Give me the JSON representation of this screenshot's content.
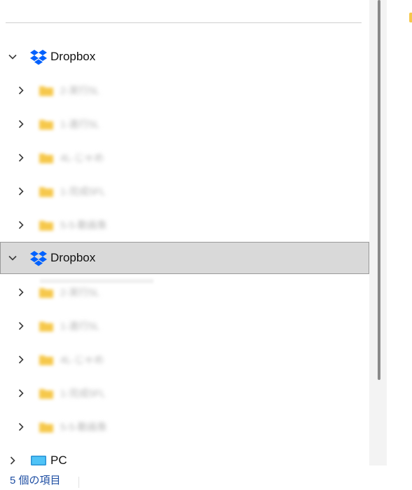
{
  "nav_tree": {
    "roots": [
      {
        "label": "Dropbox",
        "icon": "dropbox-icon",
        "expanded": true,
        "selected": false,
        "children": [
          {
            "label": "2-実行5L"
          },
          {
            "label": "1-進行5L"
          },
          {
            "label": "4L-じゃめ"
          },
          {
            "label": "1-完成5FL"
          },
          {
            "label": "5-5-動画象"
          }
        ]
      },
      {
        "label": "Dropbox",
        "icon": "dropbox-icon",
        "expanded": true,
        "selected": true,
        "children": [
          {
            "label": "2-実行5L"
          },
          {
            "label": "1-進行5L"
          },
          {
            "label": "4L-じゃめ"
          },
          {
            "label": "1-完成5FL"
          },
          {
            "label": "5-5-動画象"
          }
        ]
      }
    ],
    "pc": {
      "label": "PC",
      "icon": "monitor-icon"
    }
  },
  "status_bar": {
    "item_count": "5 個の項目"
  },
  "colors": {
    "dropbox_blue": "#0061fe",
    "folder_yellow": "#f6c84b",
    "selection_bg": "#d9d9d9",
    "status_text": "#1f4fa3"
  }
}
